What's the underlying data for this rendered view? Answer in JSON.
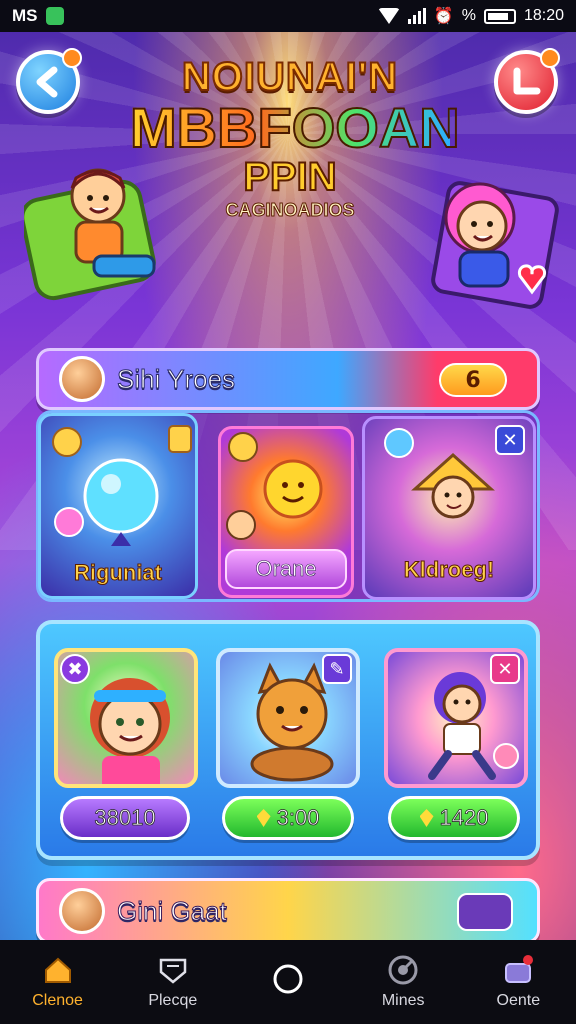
{
  "status_bar": {
    "carrier": "MS",
    "battery_percent_label": "%",
    "time": "18:20"
  },
  "header": {
    "back_icon": "back-arrow-icon",
    "close_icon": "close-icon",
    "logo_line1": "NOIUNAI'N",
    "logo_line2": "MBBFOOAN",
    "logo_line3": "PPIN",
    "logo_line4": "CAGINOADIOS"
  },
  "section1": {
    "title": "Sihi Yroes",
    "count": "6"
  },
  "featured_tiles": [
    {
      "label": "Riguniat",
      "accent": "#ffd24a"
    },
    {
      "label": "Orane",
      "accent": "#ffffff"
    },
    {
      "label": "Kldroeg!",
      "accent": "#ffd24a"
    }
  ],
  "game_cards": [
    {
      "name": "girl-character",
      "price": "38010",
      "pill_color": "#8a3ae0"
    },
    {
      "name": "cat-character",
      "price": "3:00",
      "pill_color": "#22b82e"
    },
    {
      "name": "purple-hair-character",
      "price": "1420",
      "pill_color": "#22b82e"
    }
  ],
  "section2": {
    "title": "Gini Gaat"
  },
  "bottom_nav": [
    {
      "label": "Clenoe",
      "icon": "home-icon",
      "active": true
    },
    {
      "label": "Plecqe",
      "icon": "shield-icon",
      "active": false
    },
    {
      "label": "",
      "icon": "circle-home-icon",
      "active": false
    },
    {
      "label": "Mines",
      "icon": "target-icon",
      "active": false
    },
    {
      "label": "Oente",
      "icon": "gift-icon",
      "active": false
    }
  ],
  "colors": {
    "accent_orange": "#ffb22e",
    "panel_blue": "#4ec8ff",
    "green_pill": "#22b82e",
    "purple_pill": "#8a3ae0"
  }
}
